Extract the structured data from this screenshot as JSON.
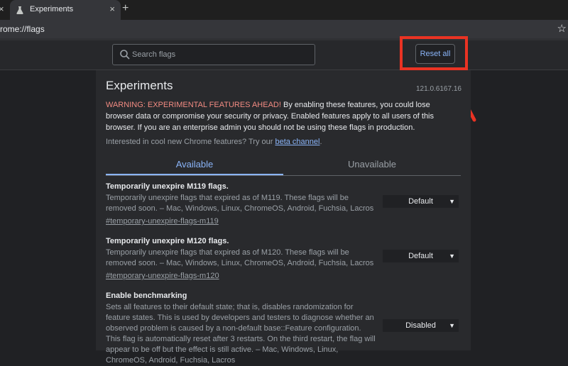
{
  "browser": {
    "tab_title": "Experiments",
    "url": "rome://flags",
    "left_close_glyph": "×",
    "tab_close_glyph": "×",
    "new_tab_glyph": "+",
    "bookmark_glyph": "☆"
  },
  "header": {
    "search_placeholder": "Search flags",
    "reset_label": "Reset all"
  },
  "page": {
    "title": "Experiments",
    "version": "121.0.6167.16",
    "warning_label": "WARNING: EXPERIMENTAL FEATURES AHEAD!",
    "warning_text": " By enabling these features, you could lose browser data or compromise your security or privacy. Enabled features apply to all users of this browser. If you are an enterprise admin you should not be using these flags in production.",
    "interest_text": "Interested in cool new Chrome features? Try our ",
    "interest_link": "beta channel",
    "interest_end": ".",
    "tabs": [
      "Available",
      "Unavailable"
    ]
  },
  "experiments": [
    {
      "name": "Temporarily unexpire M119 flags.",
      "description": "Temporarily unexpire flags that expired as of M119. These flags will be removed soon. – Mac, Windows, Linux, ChromeOS, Android, Fuchsia, Lacros",
      "link": "#temporary-unexpire-flags-m119",
      "value": "Default"
    },
    {
      "name": "Temporarily unexpire M120 flags.",
      "description": "Temporarily unexpire flags that expired as of M120. These flags will be removed soon. – Mac, Windows, Linux, ChromeOS, Android, Fuchsia, Lacros",
      "link": "#temporary-unexpire-flags-m120",
      "value": "Default"
    },
    {
      "name": "Enable benchmarking",
      "description": "Sets all features to their default state; that is, disables randomization for feature states. This is used by developers and testers to diagnose whether an observed problem is caused by a non-default base::Feature configuration. This flag is automatically reset after 3 restarts. On the third restart, the flag will appear to be off but the effect is still active. – Mac, Windows, Linux, ChromeOS, Android, Fuchsia, Lacros",
      "link": "",
      "value": "Disabled"
    }
  ],
  "colors": {
    "background": "#202124",
    "panel": "#292a2d",
    "accent": "#8ab4f8",
    "warning": "#f28b82",
    "annotation": "#ea3323"
  },
  "icons": {
    "favicon": "flask-icon",
    "search": "search-icon",
    "select_chevron": "chevron-down-icon",
    "annotation_arrow": "arrow-icon"
  }
}
